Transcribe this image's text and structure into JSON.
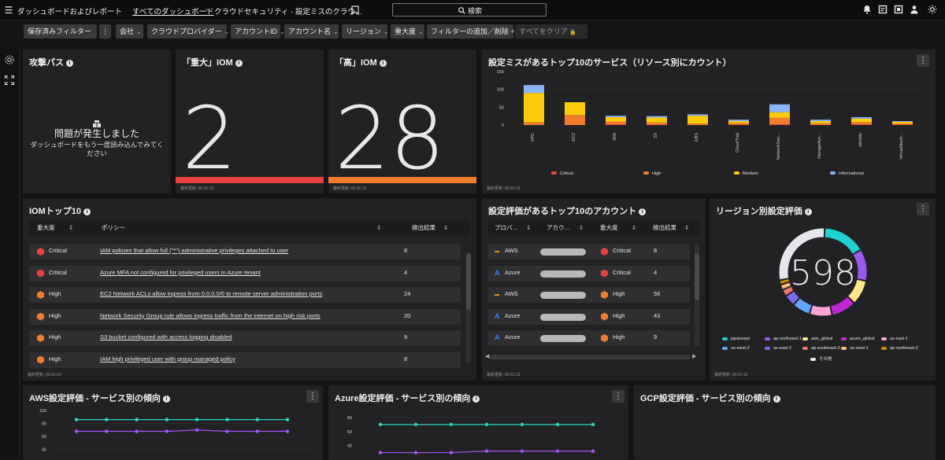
{
  "topbar": {
    "menu_icon": "hamburger-icon",
    "app_title": "ダッシュボードおよびレポート",
    "breadcrumb_link": "すべてのダッシュボード",
    "breadcrumb_sep": "›",
    "breadcrumb_current": "クラウドセキュリティ - 設定ミスのクラウ…",
    "search_label": "検索"
  },
  "filters": {
    "saved": "保存済みフィルター",
    "company": "会社",
    "provider": "クラウドプロバイダー",
    "account_id": "アカウントID",
    "account_name": "アカウント名",
    "region": "リージョン",
    "severity": "重大度",
    "add_remove": "フィルターの追加／削除",
    "add_icon": "+",
    "clear": "すべてをクリア"
  },
  "attack_path": {
    "title": "攻撃パス",
    "error_title": "問題が発生しました",
    "error_msg": "ダッシュボードをもう一度読み込んでみてください"
  },
  "critical_iom": {
    "title": "「重大」IOM",
    "value": "2",
    "updated": "最終更新: 00:01:13",
    "bar_color": "#e8423f"
  },
  "high_iom": {
    "title": "「高」IOM",
    "value": "28",
    "updated": "最終更新: 00:01:13",
    "bar_color": "#f07c2c"
  },
  "top10_services": {
    "title": "設定ミスがあるトップ10のサービス（リソース別にカウント）",
    "updated": "最終更新: 00:01:13"
  },
  "chart_data": [
    {
      "type": "bar",
      "stacked": true,
      "categories": [
        "VPC",
        "EC2",
        "IAM",
        "S3",
        "EBS",
        "CloudTrail",
        "NetworkSec...",
        "StorageAcc...",
        "Identity",
        "VirtualMach..."
      ],
      "series": [
        {
          "name": "Critical",
          "color": "#e8423f",
          "values": [
            0,
            0,
            2,
            1,
            0,
            1,
            2,
            0,
            2,
            1
          ]
        },
        {
          "name": "High",
          "color": "#f07c2c",
          "values": [
            8,
            28,
            8,
            6,
            4,
            4,
            18,
            5,
            6,
            3
          ]
        },
        {
          "name": "Medium",
          "color": "#fbcb0a",
          "values": [
            82,
            36,
            12,
            14,
            22,
            6,
            16,
            6,
            10,
            5
          ]
        },
        {
          "name": "Informational",
          "color": "#8ab4f8",
          "values": [
            22,
            0,
            4,
            4,
            4,
            4,
            22,
            4,
            4,
            2
          ]
        }
      ],
      "yticks": [
        0,
        50,
        100,
        150
      ],
      "ylim": [
        0,
        150
      ],
      "legend": "bottom"
    },
    {
      "type": "pie",
      "donut": true,
      "center_label": "598",
      "slices": [
        {
          "name": "japaneast",
          "color": "#1fd1d1",
          "value": 95
        },
        {
          "name": "ap-northeast-1",
          "color": "#9b59f0",
          "value": 70
        },
        {
          "name": "aws_global",
          "color": "#fde68a",
          "value": 55
        },
        {
          "name": "azure_global",
          "color": "#c026d3",
          "value": 55
        },
        {
          "name": "us-east-1",
          "color": "#f8a5d4",
          "value": 50
        },
        {
          "name": "us-west-2",
          "color": "#60a5fa",
          "value": 40
        },
        {
          "name": "us-east-2",
          "color": "#7c6cf0",
          "value": 25
        },
        {
          "name": "ap-southeast-2",
          "color": "#f87171",
          "value": 15
        },
        {
          "name": "us-west-1",
          "color": "#fdba74",
          "value": 12
        },
        {
          "name": "ap-northeast-2",
          "color": "#ca8a04",
          "value": 10
        },
        {
          "name": "その他",
          "color": "#e5e7eb",
          "value": 171
        }
      ],
      "legend": "bottom"
    },
    {
      "type": "line",
      "title": "AWS設定評価 - サービス別の傾向",
      "yticks": [
        40,
        60,
        80,
        100
      ],
      "ylim": [
        30,
        100
      ],
      "series": [
        {
          "color": "#2dd4bf",
          "values": [
            86,
            86,
            86,
            86,
            86,
            86,
            86,
            86
          ]
        },
        {
          "color": "#a855f7",
          "values": [
            68,
            68,
            68,
            68,
            70,
            68,
            68,
            68
          ]
        }
      ]
    },
    {
      "type": "line",
      "title": "Azure設定評価 - サービス別の傾向",
      "yticks": [
        40,
        60,
        80
      ],
      "ylim": [
        25,
        90
      ],
      "series": [
        {
          "color": "#2dd4bf",
          "values": [
            70,
            70,
            70,
            70,
            70,
            70,
            70
          ]
        },
        {
          "color": "#a855f7",
          "values": [
            30,
            30,
            30,
            32,
            32,
            32,
            32
          ]
        }
      ]
    }
  ],
  "iom_top10": {
    "title": "IOMトップ10",
    "col_severity": "重大度",
    "col_policy": "ポリシー",
    "col_results": "検出結果",
    "updated": "最終更新: 00:01:14",
    "rows": [
      {
        "severity": "Critical",
        "color": "#e8423f",
        "policy": "IAM policies that allow full (\"*\") administrative privileges attached to user",
        "count": "8"
      },
      {
        "severity": "Critical",
        "color": "#e8423f",
        "policy": "Azure MFA not configured for privileged users in Azure tenant",
        "count": "4"
      },
      {
        "severity": "High",
        "color": "#f07c2c",
        "policy": "EC2 Network ACLs allow ingress from 0.0.0.0/0 to remote server administration ports",
        "count": "24"
      },
      {
        "severity": "High",
        "color": "#f07c2c",
        "policy": "Network Security Group rule allows ingress traffic from the internet on high risk ports",
        "count": "20"
      },
      {
        "severity": "High",
        "color": "#f07c2c",
        "policy": "S3 bucket configured with access logging disabled",
        "count": "9"
      },
      {
        "severity": "High",
        "color": "#f07c2c",
        "policy": "IAM high privileged user with group managed policy",
        "count": "8"
      }
    ]
  },
  "top10_accounts": {
    "title": "設定評価があるトップ10のアカウント",
    "col_provider": "プロバ…",
    "col_account": "アカウ…",
    "col_severity": "重大度",
    "col_results": "検出結果",
    "updated": "最終更新: 00:01:13",
    "rows": [
      {
        "provider": "AWS",
        "severity": "Critical",
        "color": "#e8423f",
        "count": "8"
      },
      {
        "provider": "Azure",
        "severity": "Critical",
        "color": "#e8423f",
        "count": "4"
      },
      {
        "provider": "AWS",
        "severity": "High",
        "color": "#f07c2c",
        "count": "56"
      },
      {
        "provider": "Azure",
        "severity": "High",
        "color": "#f07c2c",
        "count": "43"
      },
      {
        "provider": "Azure",
        "severity": "High",
        "color": "#f07c2c",
        "count": "9"
      }
    ]
  },
  "region_eval": {
    "title": "リージョン別設定評価",
    "updated": "最終更新: 00:01:12"
  },
  "aws_trend": {
    "title": "AWS設定評価 - サービス別の傾向"
  },
  "azure_trend": {
    "title": "Azure設定評価 - サービス別の傾向"
  },
  "gcp_trend": {
    "title": "GCP設定評価 - サービス別の傾向"
  }
}
